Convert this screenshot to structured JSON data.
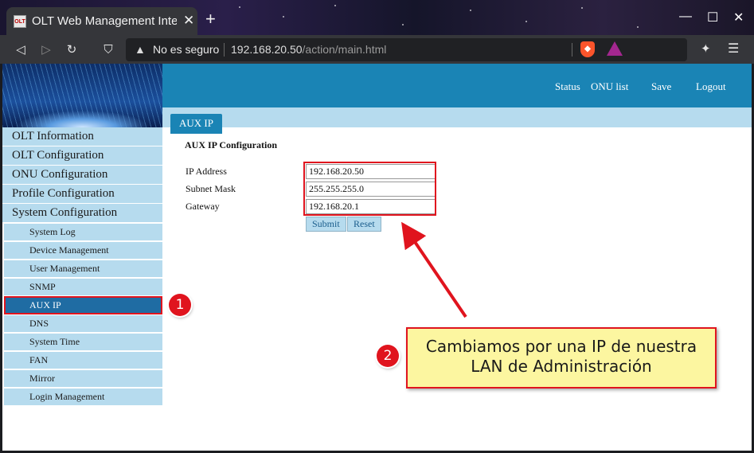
{
  "browser": {
    "tab_title": "OLT Web Management Interface",
    "tab_favicon_text": "OLT",
    "security_label": "No es seguro",
    "url_host": "192.168.20.50",
    "url_path": "/action/main.html",
    "new_tab": "+",
    "tab_close": "✕"
  },
  "topnav": {
    "status": "Status",
    "onu_list": "ONU list",
    "save": "Save",
    "logout": "Logout"
  },
  "page_tab": "AUX IP",
  "sidebar": {
    "groups": [
      "OLT Information",
      "OLT Configuration",
      "ONU Configuration",
      "Profile Configuration",
      "System Configuration"
    ],
    "subitems": [
      "System Log",
      "Device Management",
      "User Management",
      "SNMP",
      "AUX IP",
      "DNS",
      "System Time",
      "FAN",
      "Mirror",
      "Login Management"
    ]
  },
  "form": {
    "title": "AUX IP Configuration",
    "ip_label": "IP Address",
    "ip_value": "192.168.20.50",
    "mask_label": "Subnet Mask",
    "mask_value": "255.255.255.0",
    "gateway_label": "Gateway",
    "gateway_value": "192.168.20.1",
    "submit": "Submit",
    "reset": "Reset"
  },
  "annotations": {
    "badge1": "1",
    "badge2": "2",
    "callout_line1": "Cambiamos por una IP de nuestra",
    "callout_line2": "LAN de Administración"
  },
  "colors": {
    "header_blue": "#1a84b5",
    "light_blue": "#b6dbee",
    "active_item": "#1f6ca3",
    "annotation_red": "#e0141e",
    "callout_yellow": "#fcf6a0"
  }
}
